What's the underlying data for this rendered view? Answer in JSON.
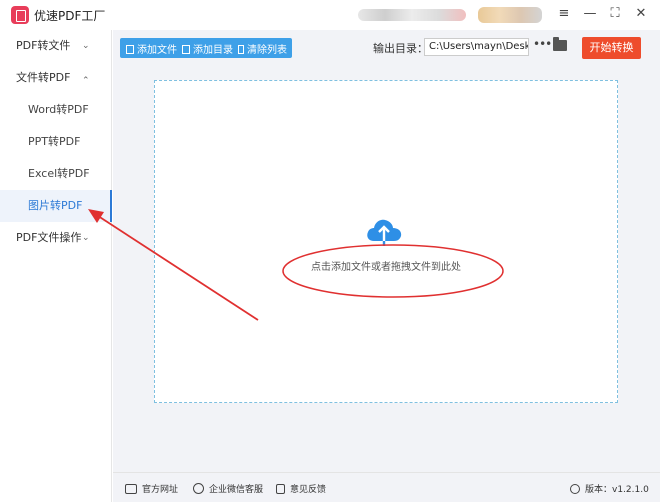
{
  "app": {
    "title": "优速PDF工厂"
  },
  "window_controls": [
    "≡",
    "—",
    "⛶",
    "✕"
  ],
  "sidebar": {
    "items": [
      {
        "label": "PDF转文件",
        "chevron": "⌄"
      },
      {
        "label": "文件转PDF",
        "chevron": "⌃"
      },
      {
        "label": "Word转PDF"
      },
      {
        "label": "PPT转PDF"
      },
      {
        "label": "Excel转PDF"
      },
      {
        "label": "图片转PDF"
      },
      {
        "label": "PDF文件操作",
        "chevron": "⌄"
      }
    ],
    "active_label": "图片转PDF"
  },
  "toolbar": {
    "add_file": "添加文件",
    "add_folder": "添加目录",
    "clear_list": "清除列表",
    "output_label": "输出目录：",
    "output_path": "C:\\Users\\mayn\\Desktop",
    "more": "•••",
    "start": "开始转换"
  },
  "dropzone": {
    "hint": "点击添加文件或者拖拽文件到此处"
  },
  "footer": {
    "website": "官方网址",
    "wechat": "企业微信客服",
    "feedback": "意见反馈",
    "version": "版本：v1.2.1.0"
  },
  "colors": {
    "accent": "#3ea0e8",
    "start": "#ee4c2c",
    "annotation": "#e03030"
  }
}
